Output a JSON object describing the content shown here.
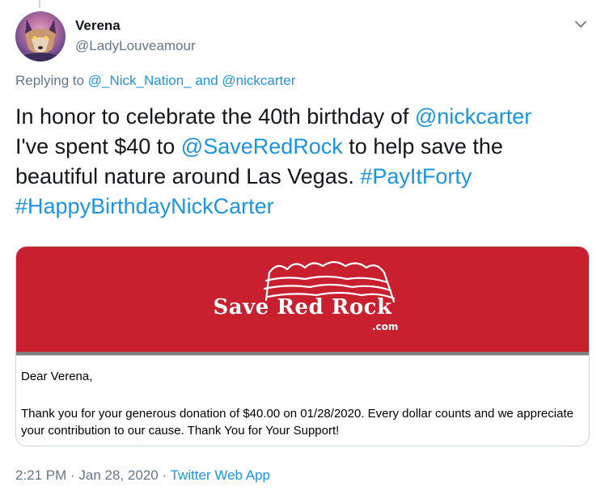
{
  "author": {
    "display_name": "Verena",
    "handle": "@LadyLouveamour"
  },
  "reply": {
    "prefix": "Replying to ",
    "mention1": "@_Nick_Nation_",
    "conj": " and ",
    "mention2": "@nickcarter"
  },
  "tweet": {
    "t1": "In honor to celebrate the 40th birthday of ",
    "m1": "@nickcarter",
    "t2": " I've spent $40 to ",
    "m2": "@SaveRedRock",
    "t3": " to help save the beautiful nature around Las Vegas. ",
    "h1": "#PayItForty",
    "h2": "#HappyBirthdayNickCarter"
  },
  "card": {
    "logo_text": "Save Red Rock",
    "logo_com": ".com",
    "greeting": "Dear Verena,",
    "body": "Thank you for your generous donation of $40.00 on 01/28/2020. Every dollar counts and we appreciate your contribution to our cause. Thank You for Your Support!"
  },
  "footer": {
    "time": "2:21 PM",
    "sep1": " · ",
    "date": "Jan 28, 2020",
    "sep2": " · ",
    "source": "Twitter Web App"
  },
  "colors": {
    "link": "#1b95e0",
    "secondary_text": "#657786",
    "banner_red": "#c8202f"
  },
  "icons": {
    "caret": "chevron-down-icon",
    "avatar": "wolf-avatar"
  }
}
